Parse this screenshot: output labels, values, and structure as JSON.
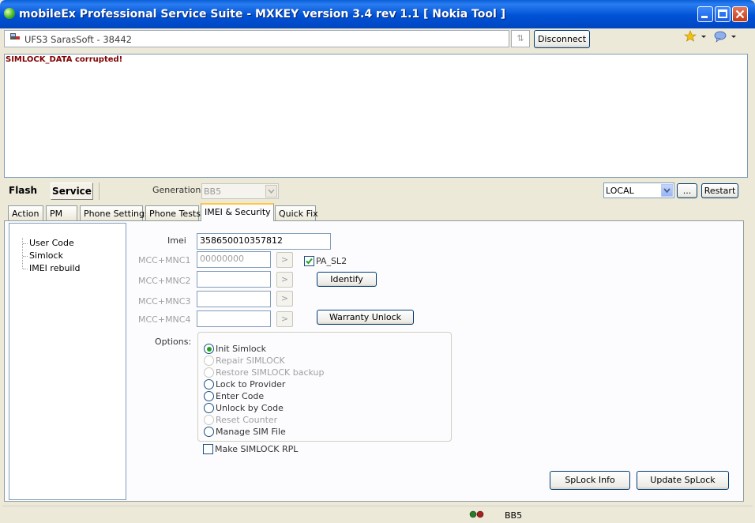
{
  "window": {
    "title": "mobileEx Professional Service Suite - MXKEY version 3.4 rev 1.1  [ Nokia Tool ]"
  },
  "toolbar": {
    "device": "UFS3 SarasSoft - 38442",
    "disconnect_label": "Disconnect"
  },
  "log": {
    "lines": [
      "SIMLOCK_DATA corrupted!"
    ]
  },
  "mode": {
    "flash": "Flash",
    "service": "Service",
    "generation_label": "Generation:",
    "generation_value": "BB5",
    "location_value": "LOCAL",
    "browse_label": "...",
    "restart_label": "Restart"
  },
  "tabs": [
    "Action",
    "PM",
    "Phone Settings",
    "Phone Tests",
    "IMEI & Security",
    "Quick Fix"
  ],
  "active_tab": "IMEI & Security",
  "tree": [
    "User Code",
    "Simlock",
    "IMEI rebuild"
  ],
  "form": {
    "imei_label": "Imei",
    "imei_value": "358650010357812",
    "mcc1_label": "MCC+MNC1",
    "mcc1_value": "00000000",
    "mcc2_label": "MCC+MNC2",
    "mcc3_label": "MCC+MNC3",
    "mcc4_label": "MCC+MNC4",
    "go_label": ">",
    "pa_sl2_label": "PA_SL2",
    "identify_label": "Identify",
    "warranty_label": "Warranty Unlock",
    "options_label": "Options:",
    "options": [
      {
        "label": "Init Simlock",
        "enabled": true,
        "selected": true
      },
      {
        "label": "Repair SIMLOCK",
        "enabled": false,
        "selected": false
      },
      {
        "label": "Restore SIMLOCK backup",
        "enabled": false,
        "selected": false
      },
      {
        "label": "Lock to Provider",
        "enabled": true,
        "selected": false
      },
      {
        "label": "Enter Code",
        "enabled": true,
        "selected": false
      },
      {
        "label": "Unlock by Code",
        "enabled": true,
        "selected": false
      },
      {
        "label": "Reset Counter",
        "enabled": false,
        "selected": false
      },
      {
        "label": "Manage SIM File",
        "enabled": true,
        "selected": false
      }
    ],
    "make_rpl_label": "Make SIMLOCK RPL",
    "splock_info_label": "SpLock Info",
    "update_splock_label": "Update SpLock"
  },
  "status": {
    "generation": "BB5"
  },
  "colors": {
    "title_bar": "#0054e3",
    "log_error": "#800000",
    "tab_highlight": "#ffc83c"
  }
}
